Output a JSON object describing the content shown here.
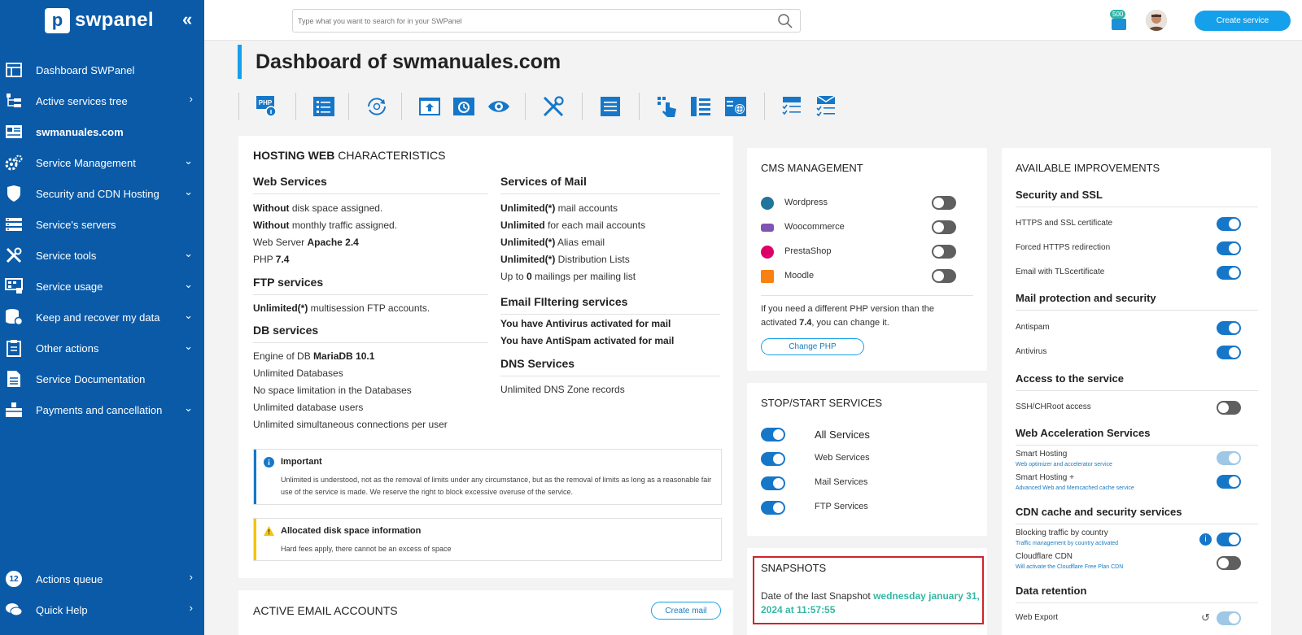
{
  "sidebar": {
    "logo_text": "swpanel",
    "collapse_icon": "double-chevron-left",
    "items": [
      {
        "label": "Dashboard SWPanel",
        "icon": "table-icon"
      },
      {
        "label": "Active services tree",
        "icon": "tree-icon"
      },
      {
        "label": "swmanuales.com",
        "icon": "site-card-icon"
      },
      {
        "label": "Service Management",
        "icon": "gears-icon"
      },
      {
        "label": "Security and CDN Hosting",
        "icon": "shield-icon"
      },
      {
        "label": "Service's servers",
        "icon": "servers-icon"
      },
      {
        "label": "Service tools",
        "icon": "tools-icon"
      },
      {
        "label": "Service usage",
        "icon": "usage-icon"
      },
      {
        "label": "Keep and recover my data",
        "icon": "database-icon"
      },
      {
        "label": "Other actions",
        "icon": "clipboard-icon"
      },
      {
        "label": "Service Documentation",
        "icon": "document-icon"
      },
      {
        "label": "Payments and cancellation",
        "icon": "payments-icon"
      }
    ],
    "bottom": {
      "queue_count": "12",
      "queue_label": "Actions queue",
      "help_label": "Quick Help"
    }
  },
  "topbar": {
    "search_placeholder": "Type what you want to search for in your SWPanel",
    "credit_badge": "500",
    "create_service_label": "Create service"
  },
  "page": {
    "title_prefix": "Dashboard of ",
    "title_domain": "swmanuales.com",
    "toolbar_icons": [
      "php-info-icon",
      "list-settings-icon",
      "sync-icon",
      "upload-icon",
      "restore-icon",
      "eye-icon",
      "tools-icon",
      "document-icon",
      "touch-grid-icon",
      "columns-icon",
      "web-settings-icon",
      "checklist-icon",
      "mail-checklist-icon"
    ]
  },
  "hosting": {
    "title_bold": "HOSTING WEB",
    "title_rest": " CHARACTERISTICS",
    "web_services": {
      "heading": "Web Services",
      "l1_b": "Without",
      "l1": " disk space assigned.",
      "l2_b": "Without",
      "l2": " monthly traffic assigned.",
      "l3": "Web Server ",
      "l3_b": "Apache 2.4",
      "l4": "PHP ",
      "l4_b": "7.4"
    },
    "ftp": {
      "heading": "FTP services",
      "l1_b": "Unlimited(*)",
      "l1": " multisession FTP accounts."
    },
    "db": {
      "heading": "DB services",
      "l1": "Engine of DB ",
      "l1_b": "MariaDB 10.1",
      "l2": "Unlimited Databases",
      "l3": "No space limitation in the Databases",
      "l4": "Unlimited database users",
      "l5": "Unlimited simultaneous connections per user"
    },
    "mail": {
      "heading": "Services of Mail",
      "l1_b": "Unlimited(*)",
      "l1": " mail accounts",
      "l2_b": "Unlimited",
      "l2": " for each mail accounts",
      "l3_b": "Unlimited(*)",
      "l3": " Alias email",
      "l4_b": "Unlimited(*)",
      "l4": " Distribution Lists",
      "l5": "Up to ",
      "l5_b": "0",
      "l5_end": " mailings per mailing list"
    },
    "filtering": {
      "heading": "Email FIltering services",
      "l1": "You have Antivirus activated for mail",
      "l2": "You have AntiSpam activated for mail"
    },
    "dns": {
      "heading": "DNS Services",
      "l1": "Unlimited DNS Zone records"
    },
    "important": {
      "title": "Important",
      "body": "Unlimited is understood, not as the removal of limits under any circumstance, but as the removal of limits as long as a reasonable fair use of the service is made. We reserve the right to block excessive overuse of the service."
    },
    "disk_info": {
      "title": "Allocated disk space information",
      "body": "Hard fees apply, there cannot be an excess of space"
    }
  },
  "email_accounts": {
    "title": "ACTIVE EMAIL ACCOUNTS",
    "create_label": "Create mail"
  },
  "cms": {
    "title": "CMS MANAGEMENT",
    "items": [
      {
        "label": "Wordpress",
        "on": false,
        "color": "#21759b"
      },
      {
        "label": "Woocommerce",
        "on": false,
        "color": "#7f54b3"
      },
      {
        "label": "PrestaShop",
        "on": false,
        "color": "#df0067"
      },
      {
        "label": "Moodle",
        "on": false,
        "color": "#f98012"
      }
    ],
    "php_text_1": "If you need a different PHP version than the",
    "php_text_2a": "activated ",
    "php_text_2b": "7.4",
    "php_text_2c": ", you can change it.",
    "change_php_label": "Change PHP"
  },
  "stopstart": {
    "title": "STOP/START SERVICES",
    "items": [
      {
        "label": "All Services",
        "on": true
      },
      {
        "label": "Web Services",
        "on": true
      },
      {
        "label": "Mail Services",
        "on": true
      },
      {
        "label": "FTP Services",
        "on": true
      }
    ]
  },
  "snapshots": {
    "title": "SNAPSHOTS",
    "label": "Date of the last Snapshot ",
    "date_1": "wednesday january 31,",
    "date_2": "2024 at 11:57:55"
  },
  "improvements": {
    "title": "AVAILABLE IMPROVEMENTS",
    "security": {
      "heading": "Security and SSL",
      "items": [
        {
          "label": "HTTPS and SSL certificate",
          "on": true
        },
        {
          "label": "Forced HTTPS redirection",
          "on": true
        },
        {
          "label": "Email with TLScertificate",
          "on": true
        }
      ]
    },
    "mail_protection": {
      "heading": "Mail protection and security",
      "items": [
        {
          "label": "Antispam",
          "on": true
        },
        {
          "label": "Antivirus",
          "on": true
        }
      ]
    },
    "access": {
      "heading": "Access to the service",
      "items": [
        {
          "label": "SSH/CHRoot access",
          "on": false
        }
      ]
    },
    "acceleration": {
      "heading": "Web Acceleration Services",
      "items": [
        {
          "label": "Smart Hosting",
          "sub": "Web optimizer and accelerator service",
          "state": "dim"
        },
        {
          "label": "Smart Hosting +",
          "sub": "Advanced Web and Memcached cache service",
          "state": "on"
        }
      ]
    },
    "cdn": {
      "heading": "CDN cache and security services",
      "items": [
        {
          "label": "Blocking traffic by country",
          "sub": "Traffic management by country activated",
          "state": "on",
          "info": "i"
        },
        {
          "label": "Cloudflare CDN",
          "sub": "Will activate the Cloudflare Free Plan CDN",
          "state": "off"
        }
      ]
    },
    "retention": {
      "heading": "Data retention",
      "items": [
        {
          "label": "Web Export",
          "state": "dim"
        }
      ]
    }
  }
}
